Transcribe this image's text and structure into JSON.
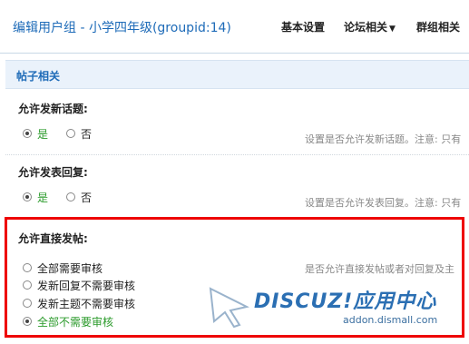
{
  "header": {
    "title": "编辑用户组 - 小学四年级(groupid:14)",
    "nav": [
      {
        "label": "基本设置",
        "dropdown": false
      },
      {
        "label": "论坛相关",
        "dropdown": true
      },
      {
        "label": "群组相关",
        "dropdown": false
      }
    ],
    "caret": "▼"
  },
  "section": {
    "title": "帖子相关"
  },
  "settings": [
    {
      "label": "允许发新话题:",
      "options": [
        {
          "label": "是",
          "checked": true
        },
        {
          "label": "否",
          "checked": false
        }
      ],
      "hint": "设置是否允许发新话题。注意: 只有"
    },
    {
      "label": "允许发表回复:",
      "options": [
        {
          "label": "是",
          "checked": true
        },
        {
          "label": "否",
          "checked": false
        }
      ],
      "hint": "设置是否允许发表回复。注意: 只有"
    },
    {
      "label": "允许直接发帖:",
      "options": [
        {
          "label": "全部需要审核",
          "checked": false
        },
        {
          "label": "发新回复不需要审核",
          "checked": false
        },
        {
          "label": "发新主题不需要审核",
          "checked": false
        },
        {
          "label": "全部不需要审核",
          "checked": true
        }
      ],
      "hint": "是否允许直接发帖或者对回复及主"
    }
  ],
  "watermark": {
    "logo": "DISCUZ!应用中心",
    "url": "addon.dismall.com"
  },
  "colors": {
    "accent": "#1e6bb8",
    "selected": "#2a9a2a",
    "highlight": "#ee0000",
    "section_bg": "#eaf2fb"
  }
}
